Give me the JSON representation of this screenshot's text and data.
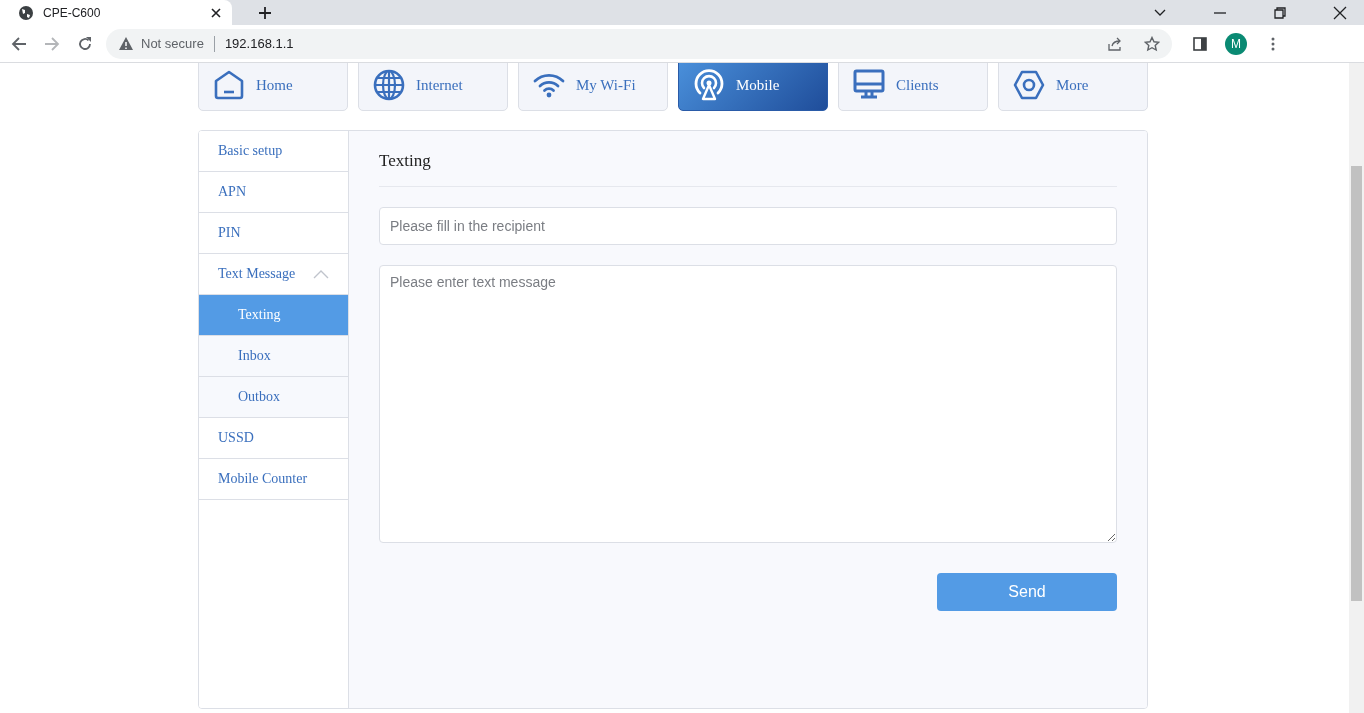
{
  "browser": {
    "tab_title": "CPE-C600",
    "security": "Not secure",
    "address": "192.168.1.1",
    "avatar": "M"
  },
  "nav_tabs": [
    {
      "label": "Home",
      "kind": "home",
      "selected": false
    },
    {
      "label": "Internet",
      "kind": "internet",
      "selected": false
    },
    {
      "label": "My Wi-Fi",
      "kind": "wifi",
      "selected": false
    },
    {
      "label": "Mobile",
      "kind": "mobile",
      "selected": true
    },
    {
      "label": "Clients",
      "kind": "clients",
      "selected": false
    },
    {
      "label": "More",
      "kind": "more",
      "selected": false
    }
  ],
  "sidebar": {
    "items": [
      {
        "label": "Basic setup",
        "selected": false
      },
      {
        "label": "APN",
        "selected": false
      },
      {
        "label": "PIN",
        "selected": false
      },
      {
        "label": "Text Message",
        "selected": false,
        "expanded": true,
        "children": [
          {
            "label": "Texting",
            "selected": true
          },
          {
            "label": "Inbox",
            "selected": false
          },
          {
            "label": "Outbox",
            "selected": false
          }
        ]
      },
      {
        "label": "USSD",
        "selected": false
      },
      {
        "label": "Mobile Counter",
        "selected": false
      }
    ]
  },
  "content": {
    "title": "Texting",
    "recipient": {
      "placeholder": "Please fill in the recipient"
    },
    "message": {
      "placeholder": "Please enter text message"
    },
    "send_button": "Send"
  }
}
